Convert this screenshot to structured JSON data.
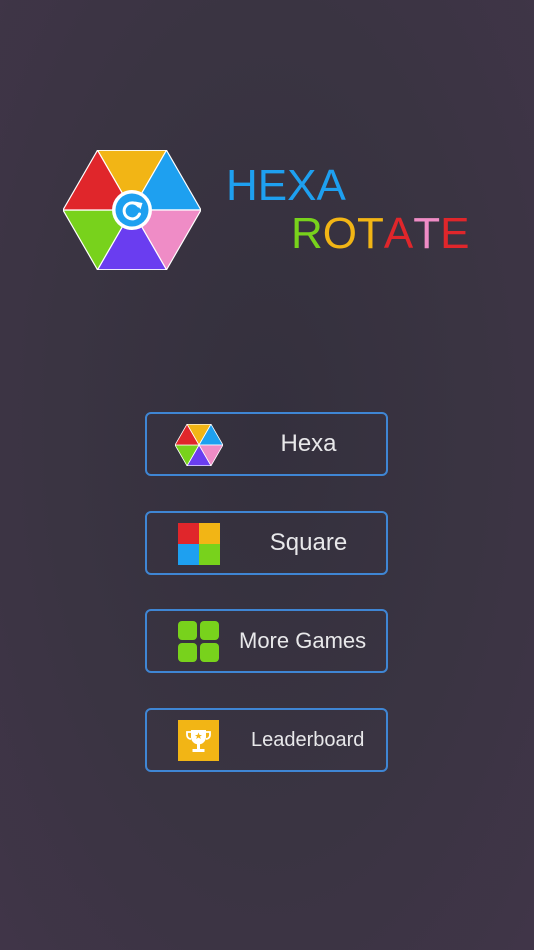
{
  "title": {
    "line1": [
      {
        "ch": "H",
        "color": "#1ea0f0"
      },
      {
        "ch": "E",
        "color": "#1ea0f0"
      },
      {
        "ch": "X",
        "color": "#1ea0f0"
      },
      {
        "ch": "A",
        "color": "#1ea0f0"
      }
    ],
    "line2": [
      {
        "ch": "R",
        "color": "#78d21c"
      },
      {
        "ch": "O",
        "color": "#f2b515"
      },
      {
        "ch": "T",
        "color": "#f2b515"
      },
      {
        "ch": "A",
        "color": "#e0262b"
      },
      {
        "ch": "T",
        "color": "#ef8cc6"
      },
      {
        "ch": "E",
        "color": "#e0262b"
      }
    ]
  },
  "logo": {
    "icon": "hexagon-rotate-icon",
    "colors": {
      "top": "#f2b515",
      "upper_right": "#1ea0f0",
      "lower_right": "#ef8cc6",
      "bottom": "#6a3df0",
      "lower_left": "#78d21c",
      "upper_left": "#e0262b"
    },
    "center_icon": "refresh-icon"
  },
  "menu": {
    "border_color": "#3f86d4",
    "buttons": [
      {
        "id": "hexa",
        "label": "Hexa",
        "icon": "hexagon-icon"
      },
      {
        "id": "square",
        "label": "Square",
        "icon": "color-squares-icon"
      },
      {
        "id": "more_games",
        "label": "More Games",
        "icon": "grid-icon"
      },
      {
        "id": "leaderboard",
        "label": "Leaderboard",
        "icon": "trophy-icon"
      }
    ]
  },
  "palette": {
    "red": "#e0262b",
    "yellow": "#f2b515",
    "blue": "#1ea0f0",
    "green": "#78d21c",
    "pink": "#ef8cc6",
    "purple": "#6a3df0",
    "leaderboard_bg": "#f2b515"
  }
}
